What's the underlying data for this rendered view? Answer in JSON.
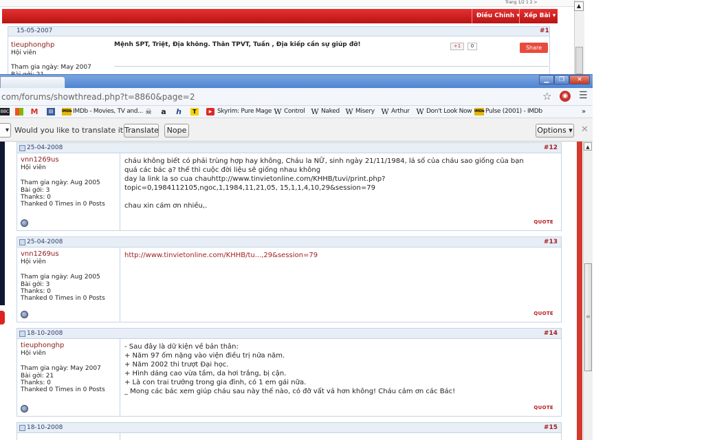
{
  "background_window": {
    "pager": "Trang 1/2  1  2  >",
    "buttons": {
      "dieu_chinh": "Điều Chỉnh ▾",
      "xep_bai": "Xếp Bài ▾"
    },
    "post": {
      "date": "15-05-2007",
      "number": "#1",
      "username": "tieuphonghp",
      "role": "Hội viên",
      "join": "Tham gia ngày: May 2007",
      "posts": "Bài gởi: 21",
      "title": "Mệnh SPT, Triệt, Địa không. Thân TPVT, Tuần , Địa kiếp cần sự giúp đỡ!",
      "gplus": "+1",
      "gcount": "0",
      "share": "Share"
    }
  },
  "browser": {
    "url": "com/forums/showthread.php?t=8860&page=2",
    "bookmarks": [
      {
        "icon": "BBC",
        "label": ""
      },
      {
        "icon": "ms",
        "label": ""
      },
      {
        "icon": "M",
        "label": ""
      },
      {
        "icon": "news",
        "label": ""
      },
      {
        "icon": "IMDb",
        "label": "IMDb - Movies, TV and..."
      },
      {
        "icon": "skull",
        "label": ""
      },
      {
        "icon": "a",
        "label": ""
      },
      {
        "icon": "h",
        "label": ""
      },
      {
        "icon": "T",
        "label": ""
      },
      {
        "icon": "yt",
        "label": "Skyrim: Pure Mage"
      },
      {
        "icon": "W",
        "label": "Control"
      },
      {
        "icon": "W",
        "label": "Naked"
      },
      {
        "icon": "W",
        "label": "Misery"
      },
      {
        "icon": "W",
        "label": "Arthur"
      },
      {
        "icon": "W",
        "label": "Don't Look Now"
      },
      {
        "icon": "IMDb",
        "label": "Pulse (2001) - IMDb"
      }
    ],
    "more": "»",
    "infobar": {
      "question": "Would you like to translate it?",
      "translate": "Translate",
      "nope": "Nope",
      "options": "Options ▾",
      "close": "✕"
    }
  },
  "posts": [
    {
      "date": "25-04-2008",
      "number": "#12",
      "username": "vnn1269us",
      "role": "Hội viên",
      "join": "Tham gia ngày: Aug 2005",
      "count": "Bài gởi: 3",
      "thanks": "Thanks: 0",
      "thanked": "Thanked 0 Times in 0 Posts",
      "lines": [
        "cháu không biết có phải trùng hợp hay không, Cháu la NỮ, sinh ngày 21/11/1984, lá số của cháu sao giống của bạn",
        "quá các bác ạ? thế thì cuộc đời liệu sẽ giống nhau không",
        "day la link la so cua chauhttp://www.tinvietonline.com/KHHB/tuvi/print.php?",
        "topic=0,1984112105,ngoc,1,1984,11,21,05, 15,1,1,4,10,29&session=79",
        "",
        "chau xin cám ơn nhiều,."
      ],
      "quote": "QUOTE"
    },
    {
      "date": "25-04-2008",
      "number": "#13",
      "username": "vnn1269us",
      "role": "Hội viên",
      "join": "Tham gia ngày: Aug 2005",
      "count": "Bài gởi: 3",
      "thanks": "Thanks: 0",
      "thanked": "Thanked 0 Times in 0 Posts",
      "link": "http://www.tinvietonline.com/KHHB/tu...,29&session=79",
      "quote": "QUOTE"
    },
    {
      "date": "18-10-2008",
      "number": "#14",
      "username": "tieuphonghp",
      "role": "Hội viên",
      "join": "Tham gia ngày: May 2007",
      "count": "Bài gởi: 21",
      "thanks": "Thanks: 0",
      "thanked": "Thanked 0 Times in 0 Posts",
      "lines": [
        "- Sau đây là dữ kiện về bản thân:",
        "+ Năm 97 ốm nặng vào viện điều trị nửa năm.",
        "+ Năm 2002 thi trượt Đại học.",
        "+ Hình dáng cao vừa tầm, da hơi trắng, bị cận.",
        "+ Là con trai trưởng trong gia đình, có 1 em gái nữa.",
        "_ Mong các bác xem giúp cháu sau này thế nào, có đỡ vất vả hơn không! Cháu cảm ơn các Bác!"
      ],
      "quote": "QUOTE"
    },
    {
      "date": "18-10-2008",
      "number": "#15"
    }
  ]
}
